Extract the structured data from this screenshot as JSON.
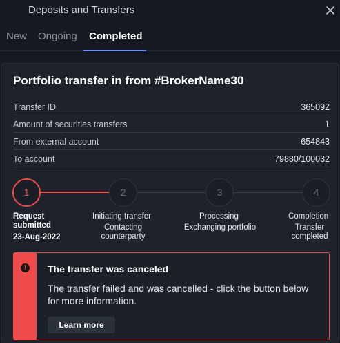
{
  "header": {
    "title": "Deposits and Transfers",
    "close_icon": "close-icon"
  },
  "tabs": [
    {
      "label": "New",
      "active": false
    },
    {
      "label": "Ongoing",
      "active": false
    },
    {
      "label": "Completed",
      "active": true
    }
  ],
  "card": {
    "title": "Portfolio transfer in from #BrokerName30",
    "details": [
      {
        "label": "Transfer ID",
        "value": "365092"
      },
      {
        "label": "Amount of securities transfers",
        "value": "1"
      },
      {
        "label": "From external account",
        "value": "654843"
      },
      {
        "label": "To account",
        "value": "79880/100032"
      }
    ]
  },
  "steps": [
    {
      "number": "1",
      "title": "Request submitted",
      "title_line1": "Request",
      "title_line2": "submitted",
      "date": "23-Aug-2022",
      "active": true
    },
    {
      "number": "2",
      "title": "Initiating transfer",
      "sub_line1": "Contacting",
      "sub_line2": "counterparty",
      "active": false
    },
    {
      "number": "3",
      "title": "Processing",
      "sub_line1": "Exchanging portfolio",
      "active": false
    },
    {
      "number": "4",
      "title": "Completion",
      "sub_line1": "Transfer",
      "sub_line2": "completed",
      "active": false
    }
  ],
  "alert": {
    "icon": "exclamation-icon",
    "title": "The transfer was canceled",
    "message": "The transfer failed and was cancelled - click the button below for more information.",
    "button_label": "Learn more"
  },
  "colors": {
    "accent": "#6f8bf5",
    "error": "#f04a4a",
    "background": "#151a22",
    "card": "#1e232b"
  }
}
